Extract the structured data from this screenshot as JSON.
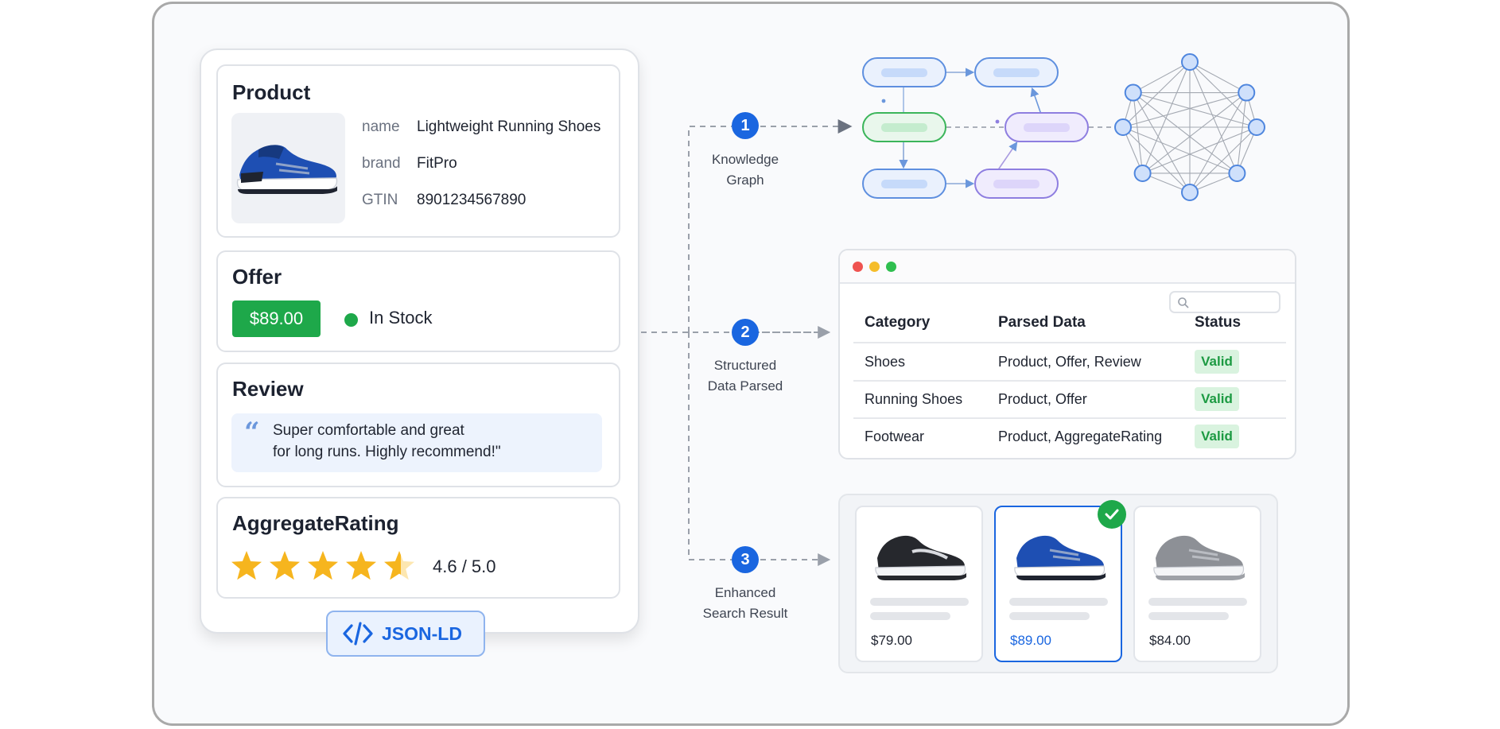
{
  "product": {
    "title": "Product",
    "props": [
      {
        "key": "name",
        "value": "Lightweight Running Shoes"
      },
      {
        "key": "brand",
        "value": "FitPro"
      },
      {
        "key": "GTIN",
        "value": "8901234567890"
      }
    ]
  },
  "offer": {
    "title": "Offer",
    "price": "$89.00",
    "availability": "In Stock"
  },
  "review": {
    "title": "Review",
    "text_line1": "Super comfortable and great",
    "text_line2": "for long runs. Highly recommend!\""
  },
  "aggregate_rating": {
    "title": "AggregateRating",
    "stars": 4.6,
    "max_stars": 5,
    "text": "4.6 / 5.0"
  },
  "format_badge": "JSON-LD",
  "steps": [
    {
      "number": "1",
      "line1": "Knowledge",
      "line2": "Graph"
    },
    {
      "number": "2",
      "line1": "Structured",
      "line2": "Data Parsed"
    },
    {
      "number": "3",
      "line1": "Enhanced",
      "line2": "Search Result"
    }
  ],
  "parsed_table": {
    "headers": [
      "Category",
      "Parsed Data",
      "Status"
    ],
    "rows": [
      [
        "Shoes",
        "Product, Offer, Review",
        "Valid"
      ],
      [
        "Running Shoes",
        "Product, Offer",
        "Valid"
      ],
      [
        "Footwear",
        "Product, AggregateRating",
        "Valid"
      ]
    ]
  },
  "search_results": [
    {
      "price": "$79.00",
      "shoe": "black-shoe",
      "selected": false
    },
    {
      "price": "$89.00",
      "shoe": "blue-shoe",
      "selected": true
    },
    {
      "price": "$84.00",
      "shoe": "gray-shoe",
      "selected": false
    }
  ],
  "colors": {
    "accent": "#1a66e0",
    "success": "#1ea84a",
    "star": "#f6b51e",
    "node_blue": "#cfe0fb",
    "node_green": "#cdeed4",
    "node_purple": "#e3dcfb"
  }
}
